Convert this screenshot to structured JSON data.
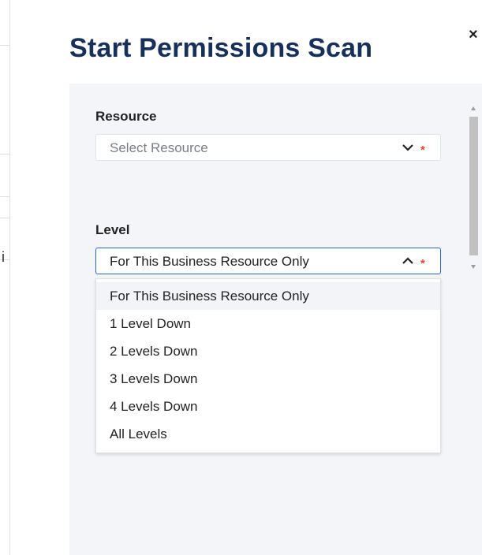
{
  "dialog": {
    "title": "Start Permissions Scan",
    "close_label": "×"
  },
  "background": {
    "clipped_text": "i"
  },
  "resource_field": {
    "label": "Resource",
    "placeholder": "Select Resource",
    "required_mark": "*",
    "chevron": "chevron-down-icon"
  },
  "level_field": {
    "label": "Level",
    "value": "For This Business Resource Only",
    "required_mark": "*",
    "chevron": "chevron-up-icon",
    "options": [
      "For This Business Resource Only",
      "1 Level Down",
      "2 Levels Down",
      "3 Levels Down",
      "4 Levels Down",
      "All Levels"
    ]
  },
  "colors": {
    "title": "#17305b",
    "panel_bg": "#f3f5f9",
    "focus_border": "#2a63c6",
    "required": "#e0442d"
  }
}
